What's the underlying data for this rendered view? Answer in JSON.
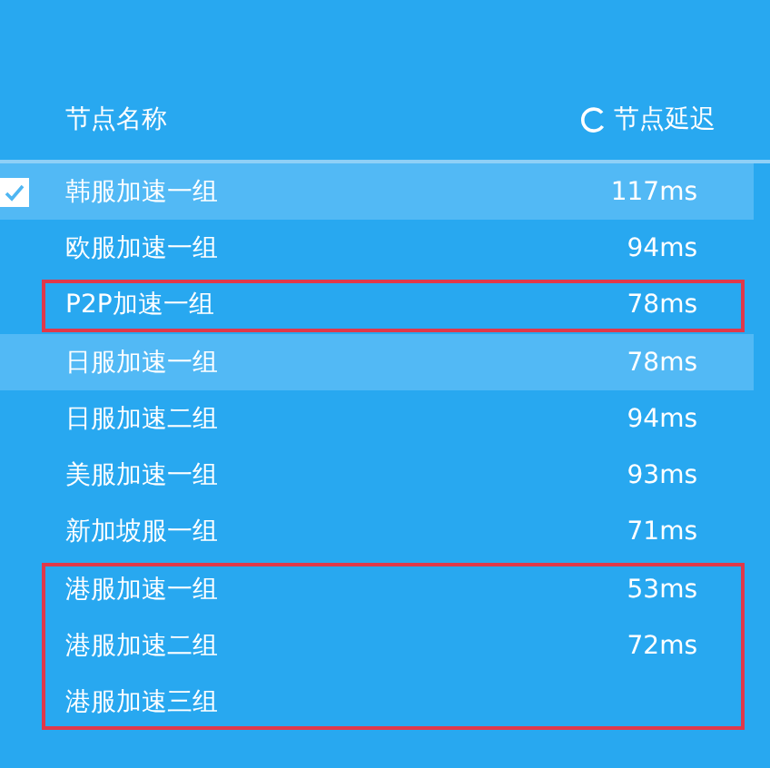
{
  "columns": {
    "name": "节点名称",
    "latency": "节点延迟"
  },
  "groups": [
    {
      "outlined": false,
      "rows": [
        {
          "name": "韩服加速一组",
          "latency": "117ms",
          "selected": true,
          "highlighted": true
        },
        {
          "name": "欧服加速一组",
          "latency": "94ms",
          "selected": false,
          "highlighted": false
        }
      ]
    },
    {
      "outlined": true,
      "rows": [
        {
          "name": "P2P加速一组",
          "latency": "78ms",
          "selected": false,
          "highlighted": false
        }
      ]
    },
    {
      "outlined": false,
      "rows": [
        {
          "name": "日服加速一组",
          "latency": "78ms",
          "selected": false,
          "highlighted": true
        },
        {
          "name": "日服加速二组",
          "latency": "94ms",
          "selected": false,
          "highlighted": false
        },
        {
          "name": "美服加速一组",
          "latency": "93ms",
          "selected": false,
          "highlighted": false
        },
        {
          "name": "新加坡服一组",
          "latency": "71ms",
          "selected": false,
          "highlighted": false
        }
      ]
    },
    {
      "outlined": true,
      "rows": [
        {
          "name": "港服加速一组",
          "latency": "53ms",
          "selected": false,
          "highlighted": false
        },
        {
          "name": "港服加速二组",
          "latency": "72ms",
          "selected": false,
          "highlighted": false
        },
        {
          "name": "港服加速三组",
          "selected": false,
          "highlighted": false
        }
      ]
    }
  ]
}
